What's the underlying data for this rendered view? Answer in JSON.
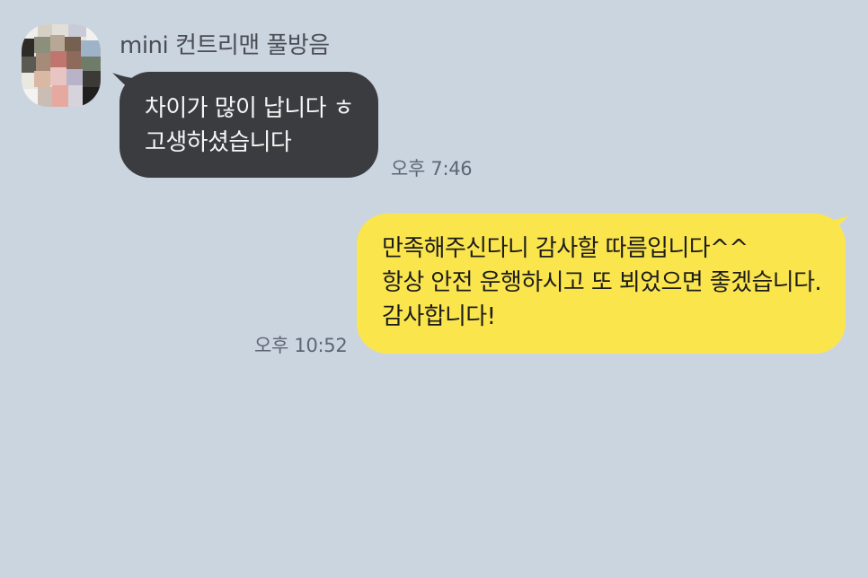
{
  "chat": {
    "incoming": {
      "sender_name": "mini 컨트리맨 풀방음",
      "message_lines": [
        "차이가 많이 납니다 ㅎ",
        "고생하셨습니다"
      ],
      "time": "오후 7:46",
      "bubble_color": "#3b3c3f"
    },
    "outgoing": {
      "message_lines": [
        "만족해주신다니 감사할 따름입니다^^",
        "항상 안전 운행하시고 또 뵈었으면 좋겠습니다.",
        "감사합니다!"
      ],
      "time": "오후 10:52",
      "bubble_color": "#fbe54d"
    }
  },
  "colors": {
    "background": "#cbd5e0",
    "incoming_text": "#f5f5f5",
    "outgoing_text": "#1c1c1c",
    "timestamp": "#5e6573"
  },
  "icons": {
    "avatar": "profile-avatar-pixelated"
  }
}
